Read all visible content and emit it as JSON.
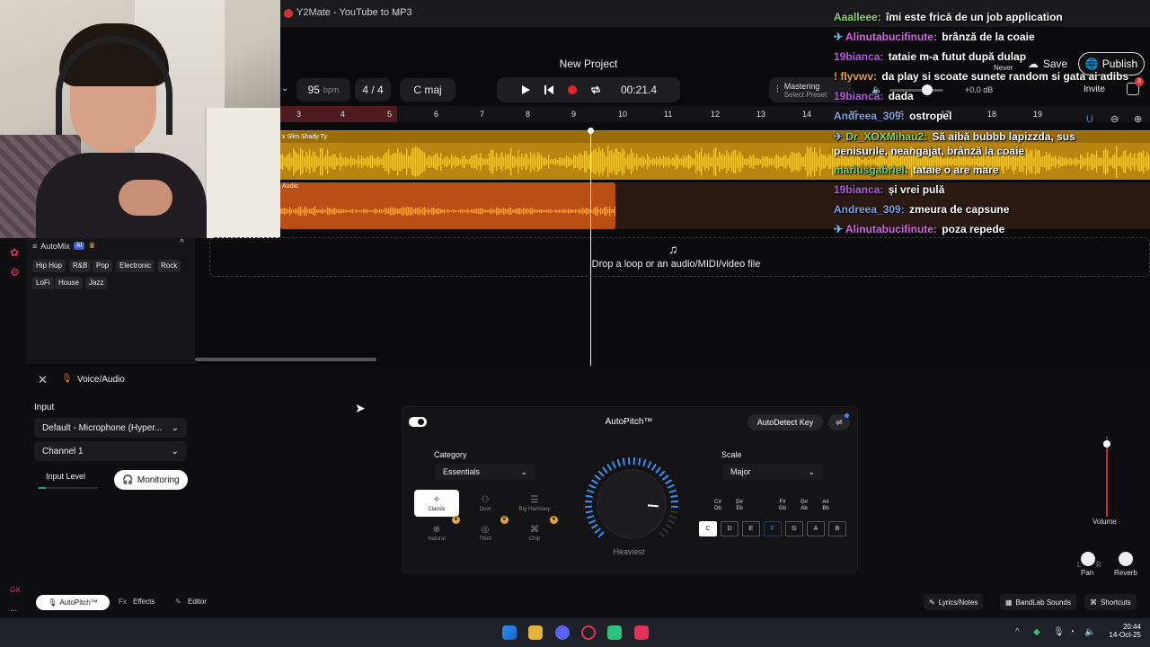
{
  "browser": {
    "tab_title": "Y2Mate - YouTube to MP3",
    "new_tab": "+"
  },
  "project": {
    "title": "New Project"
  },
  "toolbar": {
    "tempo_value": "95",
    "tempo_unit": "bpm",
    "time_signature": "4 / 4",
    "key": "C maj",
    "time": "00:21.4",
    "mastering_label": "Mastering",
    "mastering_sub": "Select Preset",
    "volume_db": "+0.0 dB",
    "never": "Never",
    "save": "Save",
    "publish": "Publish",
    "invite": "Invite",
    "cart_count": "3"
  },
  "ruler": [
    "3",
    "4",
    "5",
    "6",
    "7",
    "8",
    "9",
    "10",
    "11",
    "12",
    "13",
    "14",
    "15",
    "16",
    "17",
    "18",
    "19"
  ],
  "tracks": {
    "track1_label": "x Slim Shady Ty",
    "track2_label": "Audio"
  },
  "drop_zone": {
    "text": "Drop a loop or an audio/MIDI/video file"
  },
  "automix": {
    "title": "AutoMix",
    "ai_badge": "AI",
    "genres": [
      "Hip Hop",
      "R&B",
      "Pop",
      "Electronic",
      "Rock",
      "LoFi",
      "House",
      "Jazz"
    ]
  },
  "sidebar": {
    "gx": "GX",
    "more": "..."
  },
  "panel": {
    "title": "Voice/Audio",
    "input_label": "Input",
    "input_device": "Default - Microphone (Hyper...",
    "channel": "Channel 1",
    "input_level": "Input Level",
    "monitoring": "Monitoring"
  },
  "autopitch": {
    "title": "AutoPitch™",
    "autodetect": "AutoDetect Key",
    "category_label": "Category",
    "category_value": "Essentials",
    "scale_label": "Scale",
    "scale_value": "Major",
    "modes": [
      "Classic",
      "Duet",
      "Big Harmony",
      "Natural",
      "Third",
      "Chip"
    ],
    "knob_label": "Heaviest",
    "sharps": [
      "C# Db",
      "D# Eb",
      "F# Gb",
      "G# Ab",
      "A# Bb"
    ],
    "keys": [
      "C",
      "D",
      "E",
      "F",
      "G",
      "A",
      "B"
    ],
    "selected_key": "C",
    "highlighted_key": "F",
    "knob_amount": 0.85
  },
  "mixer": {
    "volume": "Volume",
    "pan": "Pan",
    "reverb": "Reverb",
    "pan_l": "L",
    "pan_r": "R"
  },
  "footer": {
    "autopitch": "AutoPitch™",
    "effects": "Effects",
    "fx": "Fx",
    "editor": "Editor",
    "lyrics": "Lyrics/Notes",
    "sounds": "BandLab Sounds",
    "shortcuts": "Shortcuts"
  },
  "chat": [
    {
      "user": "Aaalleee:",
      "msg": "îmi este frică de un job application",
      "color": "#8bd66b",
      "icon": ""
    },
    {
      "user": "Alinutabucifinute:",
      "msg": "brânză de la coaie",
      "color": "#d46ae0",
      "icon": "✈"
    },
    {
      "user": "19bianca:",
      "msg": "tataie m-a futut după dulap",
      "color": "#b35ae6",
      "icon": ""
    },
    {
      "user": "flyvwv:",
      "msg": "da play si scoate sunete random si gata ai adibs",
      "color": "#e6a13a",
      "icon": "!"
    },
    {
      "user": "19bianca:",
      "msg": "dada",
      "color": "#b35ae6",
      "icon": ""
    },
    {
      "user": "Andreea_309:",
      "msg": "ostropel",
      "color": "#7aa0e6",
      "icon": ""
    },
    {
      "user": "Dr_XOXMihau2:",
      "msg": "Să aibă bubbb lapizzda, sus penisurile, neangajat, brânză la coaie",
      "color": "#8bd66b",
      "icon": "✈"
    },
    {
      "user": "mariusgabriel:",
      "msg": "tataie o are mare",
      "color": "#6ad66b",
      "icon": ""
    },
    {
      "user": "19bianca:",
      "msg": "și vrei pulă",
      "color": "#b35ae6",
      "icon": ""
    },
    {
      "user": "Andreea_309:",
      "msg": "zmeura de capsune",
      "color": "#7aa0e6",
      "icon": ""
    },
    {
      "user": "Alinutabucifinute:",
      "msg": "poza repede",
      "color": "#d46ae0",
      "icon": "✈"
    }
  ],
  "taskbar": {
    "time": "20:44",
    "date": "14-Oct-25"
  }
}
